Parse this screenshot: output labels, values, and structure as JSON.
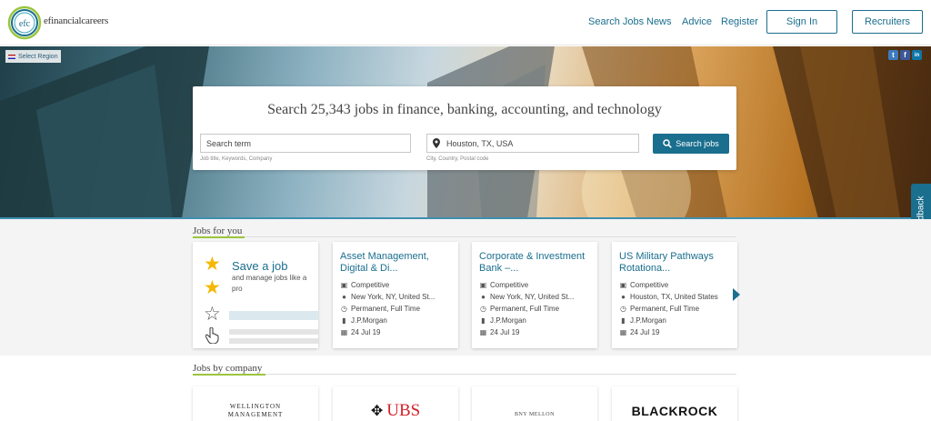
{
  "header": {
    "logo_text": "efc",
    "brand": "efinancialcareers",
    "nav": [
      "Search Jobs",
      "News",
      "Advice",
      "Register"
    ],
    "sign_in": "Sign In",
    "recruiters": "Recruiters"
  },
  "hero": {
    "select_region": "Select Region",
    "social": [
      "t",
      "f",
      "in"
    ],
    "search_title": "Search 25,343 jobs in finance, banking, accounting, and technology",
    "term_placeholder": "Search term",
    "term_help": "Job title, Keywords, Company",
    "location_value": "Houston, TX, USA",
    "location_help": "City, Country, Postal code",
    "search_button": "Search jobs",
    "feedback": "Feedback"
  },
  "jobs_for_you": {
    "title": "Jobs for you",
    "save_card": {
      "title": "Save a job",
      "subtitle": "and manage jobs like a pro"
    },
    "jobs": [
      {
        "title": "Asset Management, Digital & Di...",
        "salary": "Competitive",
        "location": "New York, NY, United St...",
        "type": "Permanent, Full Time",
        "company": "J.P.Morgan",
        "date": "24 Jul 19"
      },
      {
        "title": "Corporate & Investment Bank –...",
        "salary": "Competitive",
        "location": "New York, NY, United St...",
        "type": "Permanent, Full Time",
        "company": "J.P.Morgan",
        "date": "24 Jul 19"
      },
      {
        "title": "US Military Pathways Rotationa...",
        "salary": "Competitive",
        "location": "Houston, TX, United States",
        "type": "Permanent, Full Time",
        "company": "J.P.Morgan",
        "date": "24 Jul 19"
      }
    ]
  },
  "jobs_by_company": {
    "title": "Jobs by company",
    "companies": [
      "WELLINGTON MANAGEMENT",
      "UBS",
      "BNY MELLON",
      "BLACKROCK"
    ]
  },
  "colors": {
    "brand": "#1a6e8e",
    "accent": "#9bc53d",
    "star": "#f5b800"
  },
  "icons": [
    "location-pin-icon",
    "search-icon",
    "money-icon",
    "globe-icon",
    "clock-icon",
    "building-icon",
    "calendar-icon",
    "star-icon",
    "cursor-hand-icon",
    "flag-icon"
  ]
}
